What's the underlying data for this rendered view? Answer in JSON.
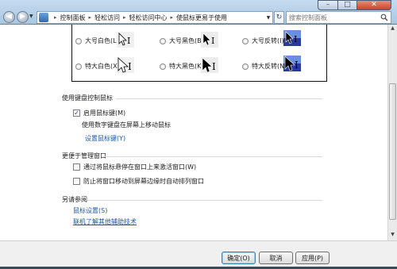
{
  "window": {
    "minimize_glyph": "–",
    "maximize_glyph": "□",
    "close_glyph": "✕"
  },
  "nav": {
    "back_glyph": "◀",
    "forward_glyph": "▶",
    "breadcrumbs": [
      "控制面板",
      "轻松访问",
      "轻松访问中心",
      "使鼠标更易于使用"
    ],
    "refresh_glyph": "↻",
    "search_placeholder": "搜索控制面板"
  },
  "pointers": {
    "schemes": [
      {
        "label": "大号白色(L)",
        "style": "light"
      },
      {
        "label": "大号黑色(B)",
        "style": "dark"
      },
      {
        "label": "大号反转(I)",
        "style": "inverted"
      },
      {
        "label": "特大白色(X)",
        "style": "light"
      },
      {
        "label": "特大黑色(K)",
        "style": "dark"
      },
      {
        "label": "特大反转(N)",
        "style": "inverted"
      }
    ]
  },
  "keyboard_section": {
    "title": "使用键盘控制鼠标",
    "enable_mouse_keys": {
      "label": "启用鼠标键(M)",
      "checked": true
    },
    "hint": "使用数字键盘在屏幕上移动鼠标",
    "setup_link": "设置鼠标键(Y)"
  },
  "window_section": {
    "title": "更便于管理窗口",
    "activate_hover": {
      "label": "通过将鼠标悬停在窗口上来激活窗口(W)",
      "checked": false
    },
    "prevent_arrange": {
      "label": "防止将窗口移动到屏幕边缘时自动排列窗口",
      "checked": false
    }
  },
  "see_also": {
    "title": "另请参阅",
    "mouse_settings": "鼠标设置(S)",
    "learn_more": "联机了解其他辅助技术"
  },
  "buttons": {
    "ok": "确定(O)",
    "cancel": "取消",
    "apply": "应用(P)"
  },
  "colors": {
    "link": "#1c58a8",
    "inverted_preview": "#2a3ba0",
    "chrome": "#a9c6e2"
  }
}
